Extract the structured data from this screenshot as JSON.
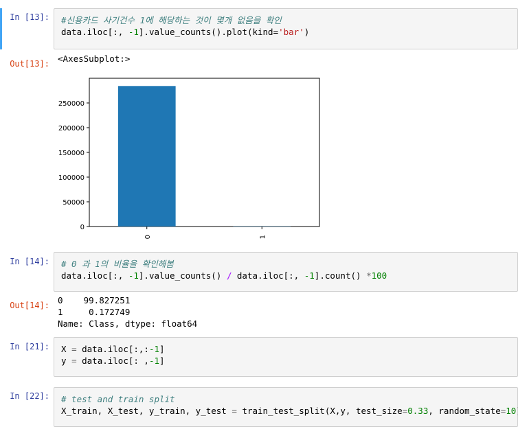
{
  "cells": [
    {
      "in_prompt": "In [13]:",
      "code_comment": "#신용카드 사기건수 1에 해당하는 것이 몇개 없음을 확인",
      "code_a": "data.iloc[:, ",
      "code_b": "-1",
      "code_c": "].value_counts().plot(kind=",
      "code_d": "'bar'",
      "code_e": ")",
      "out_prompt": "Out[13]:",
      "out_text": "<AxesSubplot:>"
    },
    {
      "in_prompt": "In [14]:",
      "code_comment": "# 0 과 1의 비율을 확인해봄",
      "code_a": "data.iloc[:, ",
      "code_b": "-1",
      "code_c": "].value_counts() ",
      "code_d": "/",
      "code_e": " data.iloc[:, ",
      "code_f": "-1",
      "code_g": "].count() ",
      "code_h": "*",
      "code_i": "100",
      "out_prompt": "Out[14]:",
      "out_lines": [
        "0    99.827251",
        "1     0.172749",
        "Name: Class, dtype: float64"
      ]
    },
    {
      "in_prompt": "In [21]:",
      "line1_a": "X ",
      "line1_b": "=",
      "line1_c": " data.iloc[:,:",
      "line1_d": "-1",
      "line1_e": "]",
      "line2_a": "y ",
      "line2_b": "=",
      "line2_c": " data.iloc[: ,",
      "line2_d": "-1",
      "line2_e": "]"
    },
    {
      "in_prompt": "In [22]:",
      "code_comment": "# test and train split",
      "code_a": "X_train, X_test, y_train, y_test ",
      "code_b": "=",
      "code_c": " train_test_split(X,y, test_size",
      "code_d": "=",
      "code_e": "0.33",
      "code_f": ", random_state",
      "code_g": "=",
      "code_h": "10",
      "code_i": ")"
    }
  ],
  "chart_data": {
    "type": "bar",
    "categories": [
      "0",
      "1"
    ],
    "values": [
      284315,
      492
    ],
    "ylim": [
      0,
      300000
    ],
    "yticks": [
      "0",
      "50000",
      "100000",
      "150000",
      "200000",
      "250000"
    ],
    "ytick_values": [
      0,
      50000,
      100000,
      150000,
      200000,
      250000
    ],
    "bar_color": "#1f77b4",
    "grid": false,
    "title": "",
    "xlabel": "",
    "ylabel": ""
  }
}
